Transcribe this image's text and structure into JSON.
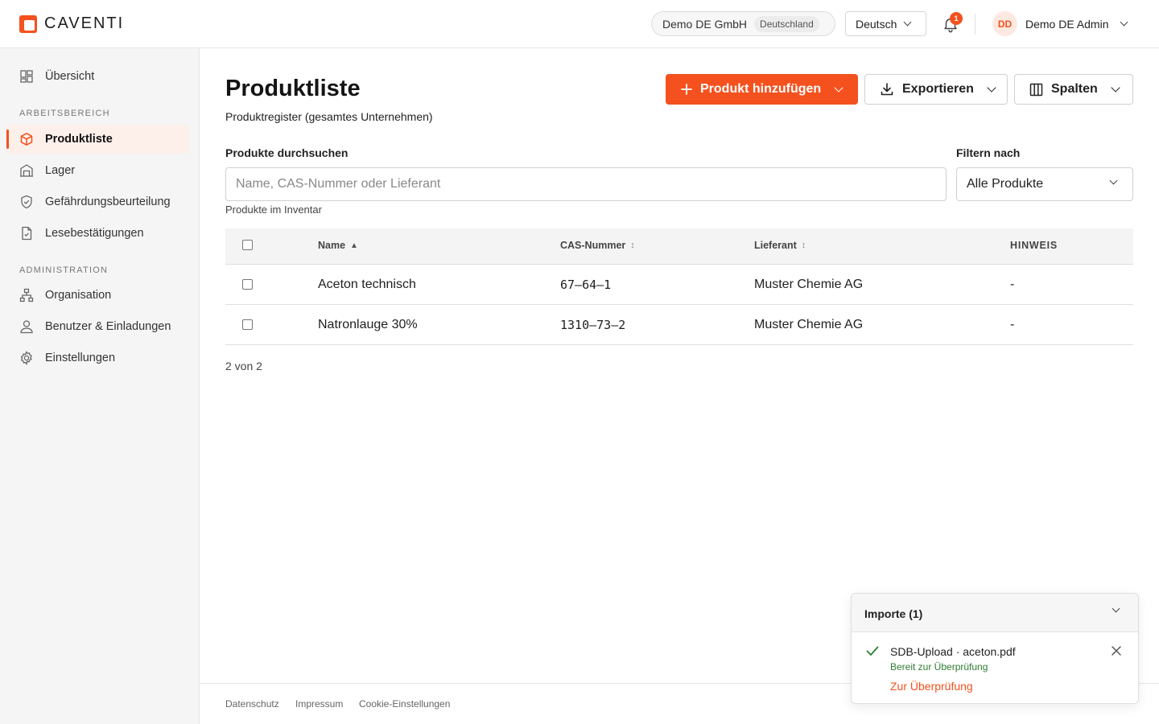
{
  "brand": {
    "name": "CAVENTI",
    "accent_color": "#f4511e"
  },
  "header": {
    "org_name": "Demo DE GmbH",
    "org_country": "Deutschland",
    "language": "Deutsch",
    "notification_count": "1",
    "user_initials": "DD",
    "user_name": "Demo DE Admin"
  },
  "sidebar": {
    "overview": {
      "label": "Übersicht",
      "icon": "dashboard-icon"
    },
    "section_work": "ARBEITSBEREICH",
    "work_items": [
      {
        "label": "Produktliste",
        "icon": "box-icon",
        "active": true
      },
      {
        "label": "Lager",
        "icon": "warehouse-icon"
      },
      {
        "label": "Gefährdungsbeurteilung",
        "icon": "shield-icon"
      },
      {
        "label": "Lesebestätigungen",
        "icon": "document-check-icon"
      }
    ],
    "section_admin": "ADMINISTRATION",
    "admin_items": [
      {
        "label": "Organisation",
        "icon": "org-chart-icon"
      },
      {
        "label": "Benutzer & Einladungen",
        "icon": "user-icon"
      },
      {
        "label": "Einstellungen",
        "icon": "gear-icon"
      }
    ]
  },
  "main": {
    "title": "Produktliste",
    "subtitle": "Produktregister (gesamtes Unternehmen)",
    "add_button": "Produkt hinzufügen",
    "export_button": "Exportieren",
    "columns_button": "Spalten",
    "search_label": "Produkte durchsuchen",
    "search_placeholder": "Name, CAS-Nummer oder Lieferant",
    "search_value": "",
    "filter_label": "Filtern nach",
    "filter_value": "Alle Produkte",
    "helper_text": "Produkte im Inventar",
    "table": {
      "columns": [
        "Name",
        "CAS-Nummer",
        "Lieferant",
        "HINWEIS"
      ],
      "rows": [
        {
          "name": "Aceton technisch",
          "cas": "67–64–1",
          "supplier": "Muster Chemie AG",
          "note": "-"
        },
        {
          "name": "Natronlauge 30%",
          "cas": "1310–73–2",
          "supplier": "Muster Chemie AG",
          "note": "-"
        }
      ]
    },
    "count_text": "2 von 2"
  },
  "footer": {
    "links": [
      "Datenschutz",
      "Impressum",
      "Cookie-Einstellungen"
    ]
  },
  "imports": {
    "title": "Importe (1)",
    "file": "SDB-Upload · aceton.pdf",
    "status": "Bereit zur Überprüfung",
    "status_color": "#2e7d32",
    "action": "Zur Überprüfung"
  }
}
